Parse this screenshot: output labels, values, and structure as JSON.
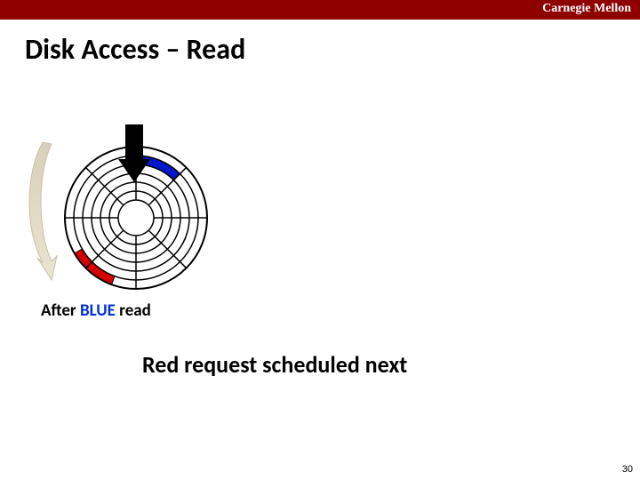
{
  "header": {
    "brand": "Carnegie Mellon"
  },
  "title": "Disk Access – Read",
  "caption_before": "After ",
  "caption_blue": "BLUE",
  "caption_after": " read",
  "subtitle": "Red request scheduled next",
  "page_number": "30",
  "diagram": {
    "tracks": 6,
    "sectors": 8,
    "blue_sector": {
      "track": 2,
      "angle_start": 270,
      "angle_end": 315
    },
    "red_sector": {
      "track": 1,
      "angle_start": 112.5,
      "angle_end": 157.5
    }
  }
}
